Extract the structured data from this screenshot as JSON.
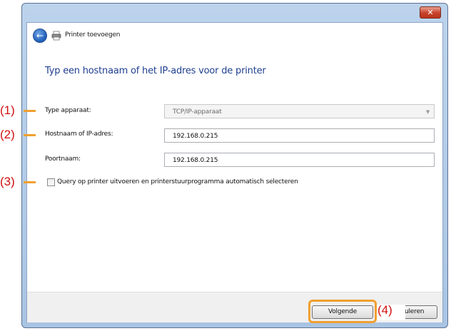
{
  "window": {
    "close_glyph": "✕",
    "title": "Printer toevoegen"
  },
  "heading": "Typ een hostnaam of het IP-adres voor de printer",
  "form": {
    "device_type": {
      "label": "Type apparaat:",
      "value": "TCP/IP-apparaat"
    },
    "host": {
      "label": "Hostnaam of IP-adres:",
      "value": "192.168.0.215"
    },
    "port": {
      "label": "Poortnaam:",
      "value": "192.168.0.215"
    },
    "query_checkbox": {
      "label": "Query op printer uitvoeren en printerstuurprogramma automatisch selecteren",
      "checked": false
    }
  },
  "buttons": {
    "next": "Volgende",
    "cancel_partial": "uleren"
  },
  "annotations": {
    "m1": "(1)",
    "m2": "(2)",
    "m3": "(3)",
    "m4": "(4)",
    "marker_color": "#d01010",
    "bar_color": "#f0a030"
  },
  "icons": {
    "back": "back-arrow-icon",
    "printer": "printer-icon",
    "dropdown": "chevron-down-icon",
    "close": "close-icon"
  }
}
